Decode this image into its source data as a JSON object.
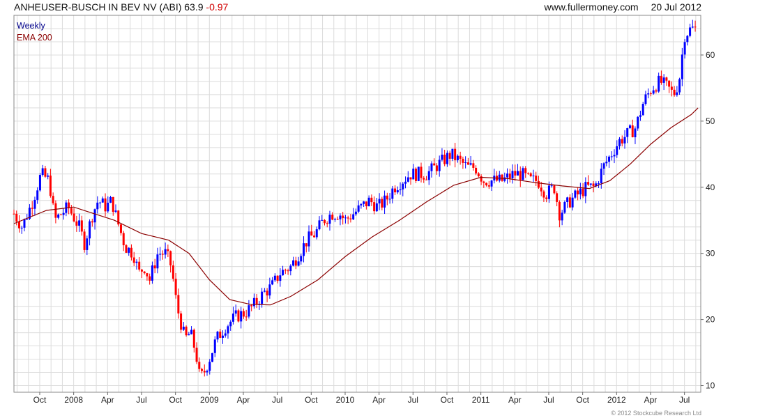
{
  "header": {
    "symbol": "ANHEUSER-BUSCH IN BEV NV (ABI)",
    "last": "63.9",
    "change": "-0.97",
    "site": "www.fullermoney.com",
    "date": "20 Jul 2012"
  },
  "legend": {
    "line1": "Weekly",
    "line2": "EMA 200"
  },
  "copyright": "© 2012 Stockcube Research Ltd",
  "colors": {
    "up": "#0000ff",
    "down": "#ff0000",
    "ema": "#8b0000",
    "grid": "#dcdcdc",
    "legend_weekly": "#00008b",
    "legend_ema": "#8b0000",
    "change": "#d10000"
  },
  "chart_data": {
    "type": "candlestick",
    "interval": "weekly",
    "title": "ANHEUSER-BUSCH IN BEV NV (ABI) 63.9 -0.97",
    "ylim": [
      9,
      66
    ],
    "y_ticks": [
      10,
      20,
      30,
      40,
      50,
      60
    ],
    "x_range": [
      2007.56,
      2012.62
    ],
    "x_ticks": [
      {
        "label": "Oct",
        "x": 2007.75
      },
      {
        "label": "2008",
        "x": 2008.0
      },
      {
        "label": "Apr",
        "x": 2008.25
      },
      {
        "label": "Jul",
        "x": 2008.5
      },
      {
        "label": "Oct",
        "x": 2008.75
      },
      {
        "label": "2009",
        "x": 2009.0
      },
      {
        "label": "Apr",
        "x": 2009.25
      },
      {
        "label": "Jul",
        "x": 2009.5
      },
      {
        "label": "Oct",
        "x": 2009.75
      },
      {
        "label": "2010",
        "x": 2010.0
      },
      {
        "label": "Apr",
        "x": 2010.25
      },
      {
        "label": "Jul",
        "x": 2010.5
      },
      {
        "label": "Oct",
        "x": 2010.75
      },
      {
        "label": "2011",
        "x": 2011.0
      },
      {
        "label": "Apr",
        "x": 2011.25
      },
      {
        "label": "Jul",
        "x": 2011.5
      },
      {
        "label": "Oct",
        "x": 2011.75
      },
      {
        "label": "2012",
        "x": 2012.0
      },
      {
        "label": "Apr",
        "x": 2012.25
      },
      {
        "label": "Jul",
        "x": 2012.5
      }
    ],
    "price_path": [
      [
        2007.56,
        36
      ],
      [
        2007.62,
        34
      ],
      [
        2007.7,
        38
      ],
      [
        2007.76,
        42
      ],
      [
        2007.82,
        41
      ],
      [
        2007.86,
        35
      ],
      [
        2007.96,
        37
      ],
      [
        2008.04,
        34
      ],
      [
        2008.08,
        31.5
      ],
      [
        2008.14,
        36
      ],
      [
        2008.18,
        38
      ],
      [
        2008.24,
        37
      ],
      [
        2008.28,
        38
      ],
      [
        2008.32,
        35
      ],
      [
        2008.38,
        31
      ],
      [
        2008.44,
        30
      ],
      [
        2008.48,
        27
      ],
      [
        2008.52,
        28
      ],
      [
        2008.56,
        26
      ],
      [
        2008.62,
        30
      ],
      [
        2008.68,
        30
      ],
      [
        2008.72,
        28
      ],
      [
        2008.76,
        22
      ],
      [
        2008.82,
        17
      ],
      [
        2008.86,
        18
      ],
      [
        2008.9,
        15
      ],
      [
        2008.93,
        11
      ],
      [
        2008.96,
        12
      ],
      [
        2009.0,
        14
      ],
      [
        2009.05,
        17
      ],
      [
        2009.12,
        19
      ],
      [
        2009.2,
        20.5
      ],
      [
        2009.26,
        21
      ],
      [
        2009.32,
        22
      ],
      [
        2009.4,
        24
      ],
      [
        2009.46,
        25
      ],
      [
        2009.52,
        27
      ],
      [
        2009.6,
        28
      ],
      [
        2009.66,
        30
      ],
      [
        2009.72,
        32
      ],
      [
        2009.78,
        33
      ],
      [
        2009.84,
        35
      ],
      [
        2009.9,
        36
      ],
      [
        2009.96,
        36
      ],
      [
        2010.0,
        35
      ],
      [
        2010.06,
        36
      ],
      [
        2010.12,
        37
      ],
      [
        2010.18,
        38
      ],
      [
        2010.24,
        37
      ],
      [
        2010.3,
        38
      ],
      [
        2010.36,
        40
      ],
      [
        2010.42,
        41
      ],
      [
        2010.48,
        42
      ],
      [
        2010.54,
        42
      ],
      [
        2010.6,
        42
      ],
      [
        2010.66,
        43
      ],
      [
        2010.72,
        44
      ],
      [
        2010.78,
        45
      ],
      [
        2010.84,
        44
      ],
      [
        2010.9,
        43
      ],
      [
        2010.96,
        43
      ],
      [
        2011.02,
        41
      ],
      [
        2011.08,
        41
      ],
      [
        2011.16,
        41
      ],
      [
        2011.24,
        42
      ],
      [
        2011.3,
        42
      ],
      [
        2011.36,
        41
      ],
      [
        2011.42,
        41
      ],
      [
        2011.48,
        39
      ],
      [
        2011.54,
        40
      ],
      [
        2011.58,
        36
      ],
      [
        2011.62,
        37
      ],
      [
        2011.66,
        38
      ],
      [
        2011.72,
        39
      ],
      [
        2011.78,
        40
      ],
      [
        2011.84,
        40
      ],
      [
        2011.9,
        43
      ],
      [
        2011.96,
        45
      ],
      [
        2012.02,
        47
      ],
      [
        2012.08,
        48
      ],
      [
        2012.14,
        49
      ],
      [
        2012.2,
        53
      ],
      [
        2012.26,
        55
      ],
      [
        2012.32,
        56
      ],
      [
        2012.38,
        55
      ],
      [
        2012.42,
        54
      ],
      [
        2012.46,
        56
      ],
      [
        2012.5,
        63
      ],
      [
        2012.55,
        64
      ],
      [
        2012.58,
        63.9
      ]
    ],
    "ema": {
      "name": "EMA 200",
      "points": [
        [
          2007.56,
          34.5
        ],
        [
          2007.8,
          36.5
        ],
        [
          2008.0,
          37
        ],
        [
          2008.3,
          35
        ],
        [
          2008.5,
          33
        ],
        [
          2008.7,
          32
        ],
        [
          2008.85,
          30
        ],
        [
          2009.0,
          26
        ],
        [
          2009.15,
          23
        ],
        [
          2009.3,
          22.3
        ],
        [
          2009.45,
          22.2
        ],
        [
          2009.6,
          23.5
        ],
        [
          2009.8,
          26
        ],
        [
          2010.0,
          29.5
        ],
        [
          2010.2,
          32.5
        ],
        [
          2010.4,
          35
        ],
        [
          2010.6,
          37.8
        ],
        [
          2010.8,
          40.3
        ],
        [
          2011.0,
          41.5
        ],
        [
          2011.2,
          41.3
        ],
        [
          2011.4,
          40.7
        ],
        [
          2011.6,
          40.2
        ],
        [
          2011.8,
          39.8
        ],
        [
          2011.95,
          41
        ],
        [
          2012.1,
          43.5
        ],
        [
          2012.25,
          46.5
        ],
        [
          2012.4,
          49
        ],
        [
          2012.55,
          51
        ],
        [
          2012.6,
          52
        ]
      ]
    }
  }
}
